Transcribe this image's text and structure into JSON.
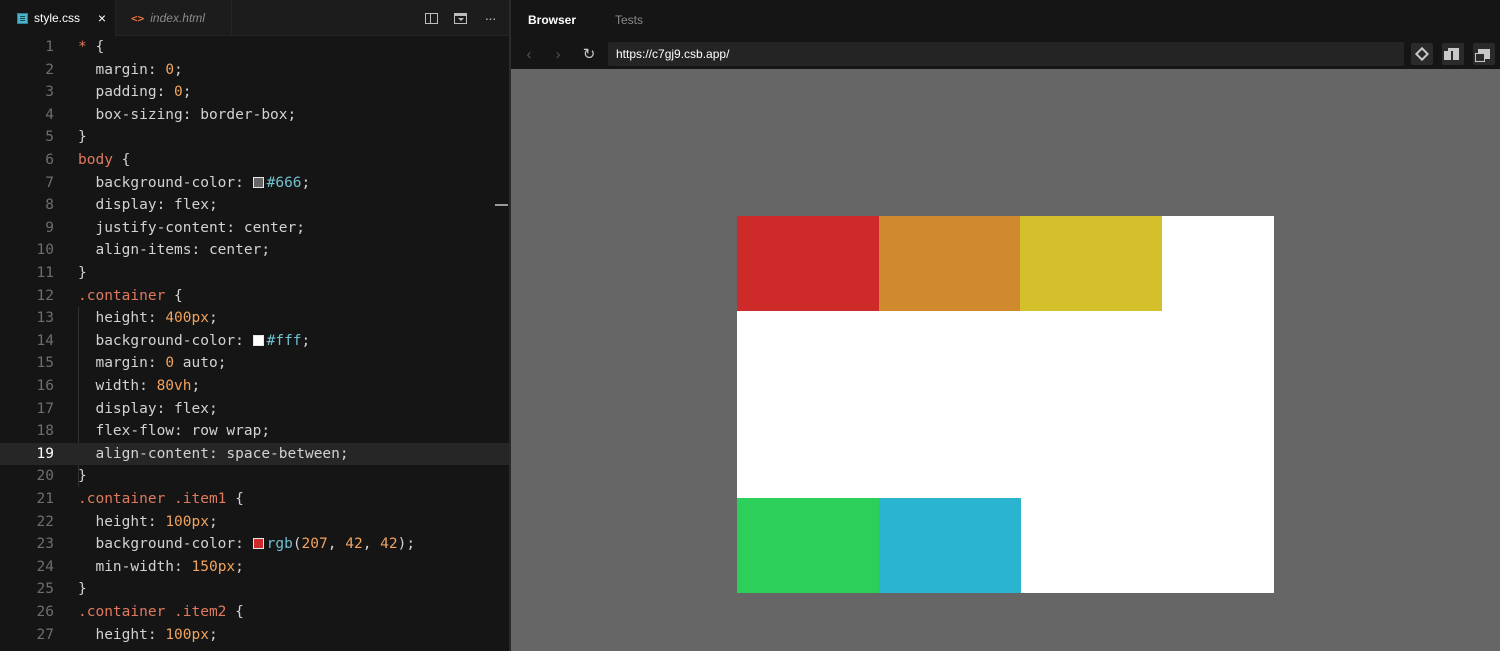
{
  "editor": {
    "tabs": [
      {
        "label": "style.css",
        "close": "×"
      },
      {
        "label": "index.html"
      }
    ],
    "toolbar": {
      "more_label": "···"
    },
    "lines": [
      {
        "n": "1",
        "segs": [
          {
            "t": "* ",
            "c": "sel"
          },
          {
            "t": "{"
          }
        ]
      },
      {
        "n": "2",
        "segs": [
          {
            "t": "  margin: "
          },
          {
            "t": "0",
            "c": "num"
          },
          {
            "t": ";"
          }
        ]
      },
      {
        "n": "3",
        "segs": [
          {
            "t": "  padding: "
          },
          {
            "t": "0",
            "c": "num"
          },
          {
            "t": ";"
          }
        ]
      },
      {
        "n": "4",
        "segs": [
          {
            "t": "  box-sizing: border-box;"
          }
        ]
      },
      {
        "n": "5",
        "segs": [
          {
            "t": "}"
          }
        ]
      },
      {
        "n": "6",
        "segs": [
          {
            "t": "body ",
            "c": "sel"
          },
          {
            "t": "{"
          }
        ]
      },
      {
        "n": "7",
        "segs": [
          {
            "t": "  background-color: "
          },
          {
            "swatch": "#666666"
          },
          {
            "t": "#666",
            "c": "hex"
          },
          {
            "t": ";"
          }
        ]
      },
      {
        "n": "8",
        "segs": [
          {
            "t": "  display: flex;"
          }
        ]
      },
      {
        "n": "9",
        "segs": [
          {
            "t": "  justify-content: center;"
          }
        ]
      },
      {
        "n": "10",
        "segs": [
          {
            "t": "  align-items: center;"
          }
        ]
      },
      {
        "n": "11",
        "segs": [
          {
            "t": "}"
          }
        ]
      },
      {
        "n": "12",
        "segs": [
          {
            "t": ".container ",
            "c": "sel"
          },
          {
            "t": "{"
          }
        ]
      },
      {
        "n": "13",
        "segs": [
          {
            "t": "  height: "
          },
          {
            "t": "400px",
            "c": "num"
          },
          {
            "t": ";"
          }
        ]
      },
      {
        "n": "14",
        "segs": [
          {
            "t": "  background-color: "
          },
          {
            "swatch": "#ffffff"
          },
          {
            "t": "#fff",
            "c": "hex"
          },
          {
            "t": ";"
          }
        ]
      },
      {
        "n": "15",
        "segs": [
          {
            "t": "  margin: "
          },
          {
            "t": "0",
            "c": "num"
          },
          {
            "t": " auto;"
          }
        ]
      },
      {
        "n": "16",
        "segs": [
          {
            "t": "  width: "
          },
          {
            "t": "80vh",
            "c": "num"
          },
          {
            "t": ";"
          }
        ]
      },
      {
        "n": "17",
        "segs": [
          {
            "t": "  display: flex;"
          }
        ]
      },
      {
        "n": "18",
        "segs": [
          {
            "t": "  flex-flow: row wrap;"
          }
        ]
      },
      {
        "n": "19",
        "segs": [
          {
            "t": "  align-content: space-between;"
          }
        ],
        "active": true
      },
      {
        "n": "20",
        "segs": [
          {
            "t": "}"
          }
        ]
      },
      {
        "n": "21",
        "segs": [
          {
            "t": ".container .item1 ",
            "c": "sel"
          },
          {
            "t": "{"
          }
        ]
      },
      {
        "n": "22",
        "segs": [
          {
            "t": "  height: "
          },
          {
            "t": "100px",
            "c": "num"
          },
          {
            "t": ";"
          }
        ]
      },
      {
        "n": "23",
        "segs": [
          {
            "t": "  background-color: "
          },
          {
            "swatch": "#cf2a2a"
          },
          {
            "t": "rgb",
            "c": "fn"
          },
          {
            "t": "("
          },
          {
            "t": "207",
            "c": "num"
          },
          {
            "t": ", "
          },
          {
            "t": "42",
            "c": "num"
          },
          {
            "t": ", "
          },
          {
            "t": "42",
            "c": "num"
          },
          {
            "t": ");"
          }
        ]
      },
      {
        "n": "24",
        "segs": [
          {
            "t": "  min-width: "
          },
          {
            "t": "150px",
            "c": "num"
          },
          {
            "t": ";"
          }
        ]
      },
      {
        "n": "25",
        "segs": [
          {
            "t": "}"
          }
        ]
      },
      {
        "n": "26",
        "segs": [
          {
            "t": ".container .item2 ",
            "c": "sel"
          },
          {
            "t": "{"
          }
        ]
      },
      {
        "n": "27",
        "segs": [
          {
            "t": "  height: "
          },
          {
            "t": "100px",
            "c": "num"
          },
          {
            "t": ";"
          }
        ]
      }
    ]
  },
  "browser": {
    "tabs": {
      "browser": "Browser",
      "tests": "Tests"
    },
    "nav": {
      "back": "‹",
      "forward": "›",
      "refresh": "↻"
    },
    "url": "https://c7gj9.csb.app/",
    "preview": {
      "container_color": "#ffffff",
      "items": [
        {
          "name": "item-1",
          "color": "#cf2a2a"
        },
        {
          "name": "item-2",
          "color": "#d0892d"
        },
        {
          "name": "item-3",
          "color": "#d4c02b"
        },
        {
          "name": "item-4",
          "color": "#2bcf5a"
        },
        {
          "name": "item-5",
          "color": "#2bb4cf"
        }
      ]
    }
  },
  "colors": {
    "editor_bg": "#151515",
    "selector": "#e07a5f",
    "number": "#f0a35e",
    "hex_value": "#70c0d0",
    "preview_bg": "#666666"
  }
}
